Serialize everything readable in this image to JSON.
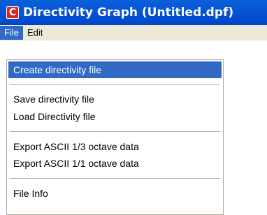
{
  "window": {
    "icon_letter": "C",
    "title": "Directivity Graph  (Untitled.dpf)"
  },
  "menubar": {
    "file_label": "File",
    "edit_label": "Edit"
  },
  "file_menu": {
    "items": [
      {
        "label": "Create directivity file",
        "highlighted": true
      },
      {
        "label": "Save directivity file"
      },
      {
        "label": "Load Directivity file"
      },
      {
        "label": "Export ASCII 1/3 octave data"
      },
      {
        "label": "Export ASCII 1/1 octave data"
      },
      {
        "label": "File Info"
      }
    ]
  },
  "colors": {
    "titlebar": "#0a5fd8",
    "highlight": "#316ac5",
    "menubar_bg": "#ece9d8",
    "app_icon": "#d8281e"
  }
}
